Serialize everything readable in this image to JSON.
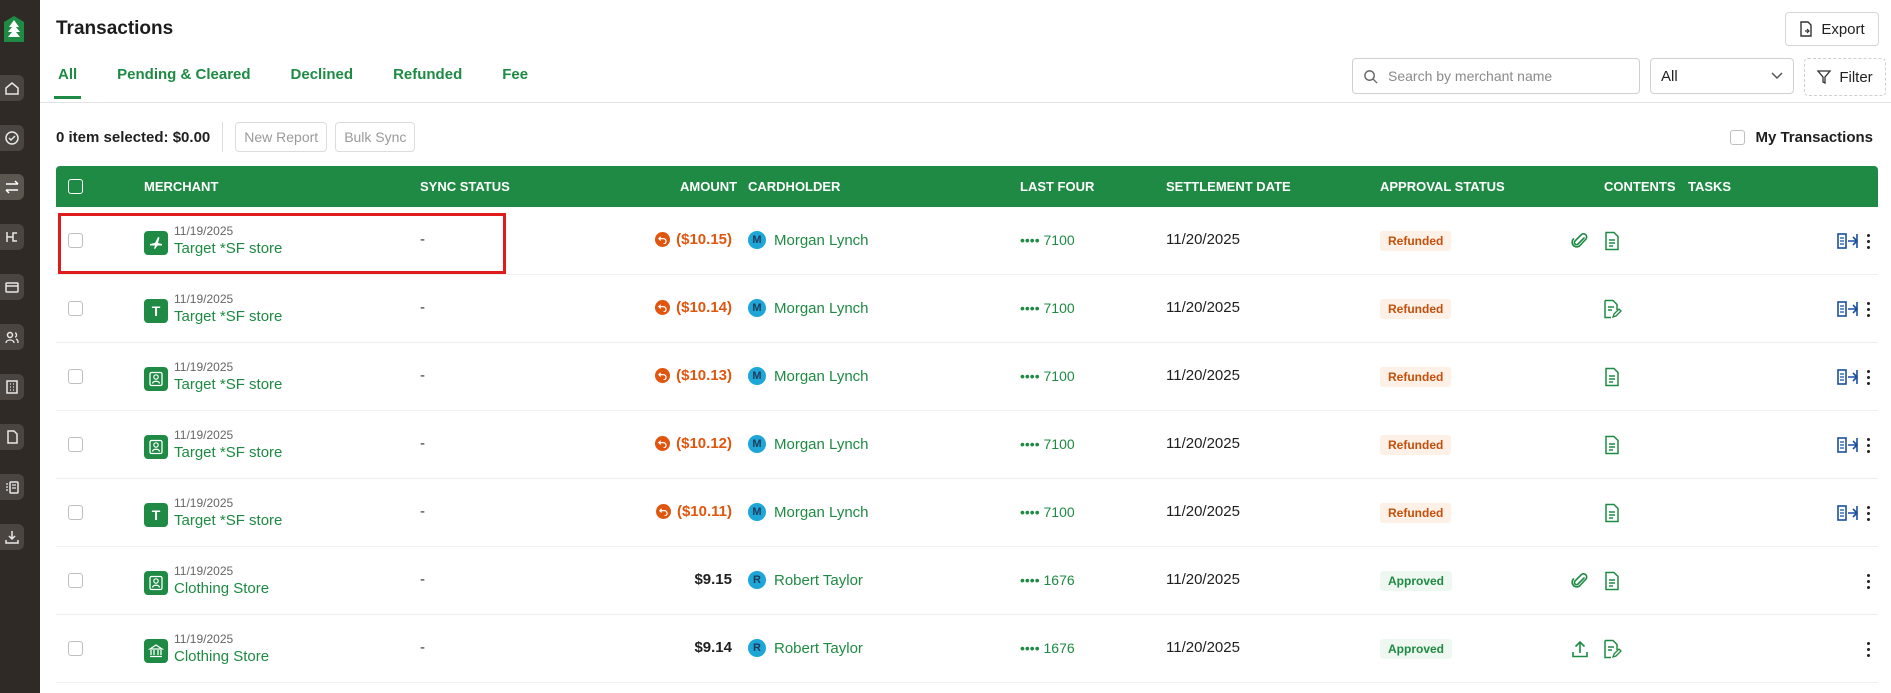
{
  "header": {
    "title": "Transactions",
    "export_label": "Export"
  },
  "tabs": [
    {
      "label": "All",
      "active": true
    },
    {
      "label": "Pending & Cleared",
      "active": false
    },
    {
      "label": "Declined",
      "active": false
    },
    {
      "label": "Refunded",
      "active": false
    },
    {
      "label": "Fee",
      "active": false
    }
  ],
  "search": {
    "placeholder": "Search by merchant name",
    "value": ""
  },
  "status_select": {
    "value": "All"
  },
  "filter_label": "Filter",
  "selection": {
    "summary": "0 item selected: $0.00",
    "new_report_label": "New Report",
    "bulk_sync_label": "Bulk Sync"
  },
  "my_transactions_label": "My Transactions",
  "table": {
    "columns": [
      "MERCHANT",
      "SYNC STATUS",
      "AMOUNT",
      "CARDHOLDER",
      "LAST FOUR",
      "SETTLEMENT DATE",
      "APPROVAL STATUS",
      "CONTENTS",
      "TASKS"
    ],
    "rows": [
      {
        "icon": "airplane",
        "date": "11/19/2025",
        "merchant": "Target *SF store",
        "sync": "-",
        "amount": "($10.15)",
        "refund": true,
        "holder_initial": "M",
        "holder": "Morgan Lynch",
        "last_four": "•••• 7100",
        "settlement": "11/20/2025",
        "status": "Refunded",
        "contents": [
          "attachment",
          "receipt"
        ],
        "split": true
      },
      {
        "icon": "letter",
        "letter": "T",
        "date": "11/19/2025",
        "merchant": "Target *SF store",
        "sync": "-",
        "amount": "($10.14)",
        "refund": true,
        "holder_initial": "M",
        "holder": "Morgan Lynch",
        "last_four": "•••• 7100",
        "settlement": "11/20/2025",
        "status": "Refunded",
        "contents": [
          "receipt-edit"
        ],
        "split": true
      },
      {
        "icon": "person",
        "date": "11/19/2025",
        "merchant": "Target *SF store",
        "sync": "-",
        "amount": "($10.13)",
        "refund": true,
        "holder_initial": "M",
        "holder": "Morgan Lynch",
        "last_four": "•••• 7100",
        "settlement": "11/20/2025",
        "status": "Refunded",
        "contents": [
          "receipt"
        ],
        "split": true
      },
      {
        "icon": "person",
        "date": "11/19/2025",
        "merchant": "Target *SF store",
        "sync": "-",
        "amount": "($10.12)",
        "refund": true,
        "holder_initial": "M",
        "holder": "Morgan Lynch",
        "last_four": "•••• 7100",
        "settlement": "11/20/2025",
        "status": "Refunded",
        "contents": [
          "receipt"
        ],
        "split": true
      },
      {
        "icon": "letter",
        "letter": "T",
        "date": "11/19/2025",
        "merchant": "Target *SF store",
        "sync": "-",
        "amount": "($10.11)",
        "refund": true,
        "holder_initial": "M",
        "holder": "Morgan Lynch",
        "last_four": "•••• 7100",
        "settlement": "11/20/2025",
        "status": "Refunded",
        "contents": [
          "receipt"
        ],
        "split": true
      },
      {
        "icon": "person",
        "date": "11/19/2025",
        "merchant": "Clothing Store",
        "sync": "-",
        "amount": "$9.15",
        "refund": false,
        "holder_initial": "R",
        "holder": "Robert Taylor",
        "last_four": "•••• 1676",
        "settlement": "11/20/2025",
        "status": "Approved",
        "contents": [
          "attachment",
          "receipt"
        ],
        "split": false
      },
      {
        "icon": "bank",
        "date": "11/19/2025",
        "merchant": "Clothing Store",
        "sync": "-",
        "amount": "$9.14",
        "refund": false,
        "holder_initial": "R",
        "holder": "Robert Taylor",
        "last_four": "•••• 1676",
        "settlement": "11/20/2025",
        "status": "Approved",
        "contents": [
          "upload",
          "receipt-edit"
        ],
        "split": false
      }
    ]
  },
  "colors": {
    "brand_green": "#1e8a43",
    "refund_orange": "#e0560e",
    "highlight_red": "#e01b1b",
    "sidebar_dark": "#2f2a26"
  }
}
